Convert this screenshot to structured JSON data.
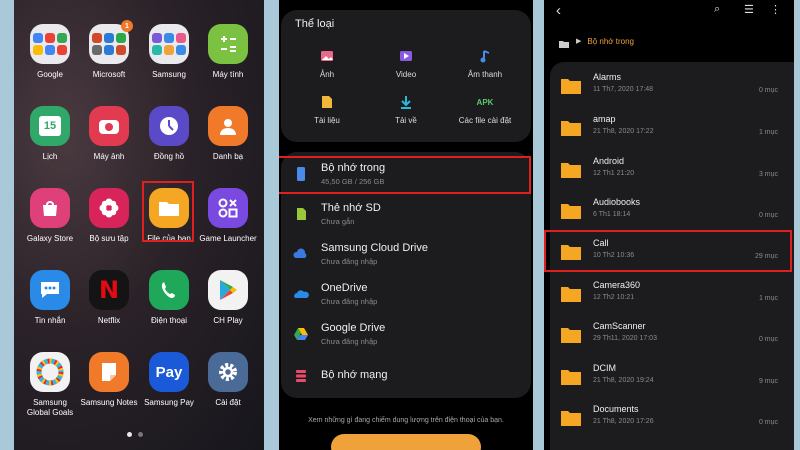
{
  "home": {
    "apps": [
      {
        "label": "Google",
        "icon": "google-folder-icon"
      },
      {
        "label": "Microsoft",
        "icon": "microsoft-folder-icon",
        "badge": "1"
      },
      {
        "label": "Samsung",
        "icon": "samsung-folder-icon"
      },
      {
        "label": "Máy tính",
        "icon": "calculator-icon"
      },
      {
        "label": "Lịch",
        "icon": "calendar-icon",
        "day": "15"
      },
      {
        "label": "Máy ảnh",
        "icon": "camera-icon"
      },
      {
        "label": "Đồng hồ",
        "icon": "clock-icon"
      },
      {
        "label": "Danh bạ",
        "icon": "contacts-icon"
      },
      {
        "label": "Galaxy Store",
        "icon": "galaxy-store-icon"
      },
      {
        "label": "Bộ sưu tập",
        "icon": "gallery-icon"
      },
      {
        "label": "File của bạn",
        "icon": "my-files-icon"
      },
      {
        "label": "Game Launcher",
        "icon": "game-launcher-icon"
      },
      {
        "label": "Tin nhắn",
        "icon": "messages-icon"
      },
      {
        "label": "Netflix",
        "icon": "netflix-icon",
        "glyph": "N"
      },
      {
        "label": "Điện thoại",
        "icon": "phone-icon"
      },
      {
        "label": "CH Play",
        "icon": "play-store-icon"
      },
      {
        "label": "Samsung Global Goals",
        "label1": "Samsung",
        "label2": "Global Goals",
        "icon": "global-goals-icon"
      },
      {
        "label": "Samsung Notes",
        "icon": "notes-icon"
      },
      {
        "label": "Samsung Pay",
        "icon": "samsung-pay-icon",
        "glyph": "Pay"
      },
      {
        "label": "Cài đặt",
        "icon": "settings-icon"
      }
    ]
  },
  "myfiles": {
    "categories_title": "Thể loại",
    "categories": [
      {
        "label": "Ảnh",
        "icon": "image-icon"
      },
      {
        "label": "Video",
        "icon": "video-icon"
      },
      {
        "label": "Âm thanh",
        "icon": "audio-icon"
      },
      {
        "label": "Tài liệu",
        "icon": "document-icon"
      },
      {
        "label": "Tải về",
        "icon": "download-icon"
      },
      {
        "label": "Các file cài đặt",
        "icon": "apk-icon",
        "glyph": "APK"
      }
    ],
    "storage": [
      {
        "name": "Bộ nhớ trong",
        "sub": "45,50 GB / 256 GB",
        "icon": "phone-storage-icon"
      },
      {
        "name": "Thẻ nhớ SD",
        "sub": "Chưa gắn",
        "icon": "sd-card-icon"
      },
      {
        "name": "Samsung Cloud Drive",
        "sub": "Chưa đăng nhập",
        "icon": "samsung-cloud-icon"
      },
      {
        "name": "OneDrive",
        "sub": "Chưa đăng nhập",
        "icon": "onedrive-icon"
      },
      {
        "name": "Google Drive",
        "sub": "Chưa đăng nhập",
        "icon": "google-drive-icon"
      },
      {
        "name": "Bộ nhớ mạng",
        "sub": "",
        "icon": "network-storage-icon"
      }
    ],
    "bottom_text": "Xem những gì đang chiếm dung lượng trên điện thoại của bạn."
  },
  "folder": {
    "breadcrumb": "Bộ nhớ trong",
    "items": [
      {
        "name": "Alarms",
        "date": "11 Th7, 2020 17:48",
        "count": "0 mục"
      },
      {
        "name": "amap",
        "date": "21 Th8, 2020 17:22",
        "count": "1 mục"
      },
      {
        "name": "Android",
        "date": "12 Th1 21:20",
        "count": "3 mục"
      },
      {
        "name": "Audiobooks",
        "date": "6 Th1 18:14",
        "count": "0 mục"
      },
      {
        "name": "Call",
        "date": "10 Th2 10:36",
        "count": "29 mục"
      },
      {
        "name": "Camera360",
        "date": "12 Th2 10:21",
        "count": "1 mục"
      },
      {
        "name": "CamScanner",
        "date": "29 Th11, 2020 17:03",
        "count": "0 mục"
      },
      {
        "name": "DCIM",
        "date": "21 Th8, 2020 19:24",
        "count": "9 mục"
      },
      {
        "name": "Documents",
        "date": "21 Th8, 2020 17:26",
        "count": "0 mục"
      }
    ]
  },
  "colors": {
    "accent": "#f0a23a",
    "highlight": "#e02020",
    "folder": "#f5a623"
  }
}
